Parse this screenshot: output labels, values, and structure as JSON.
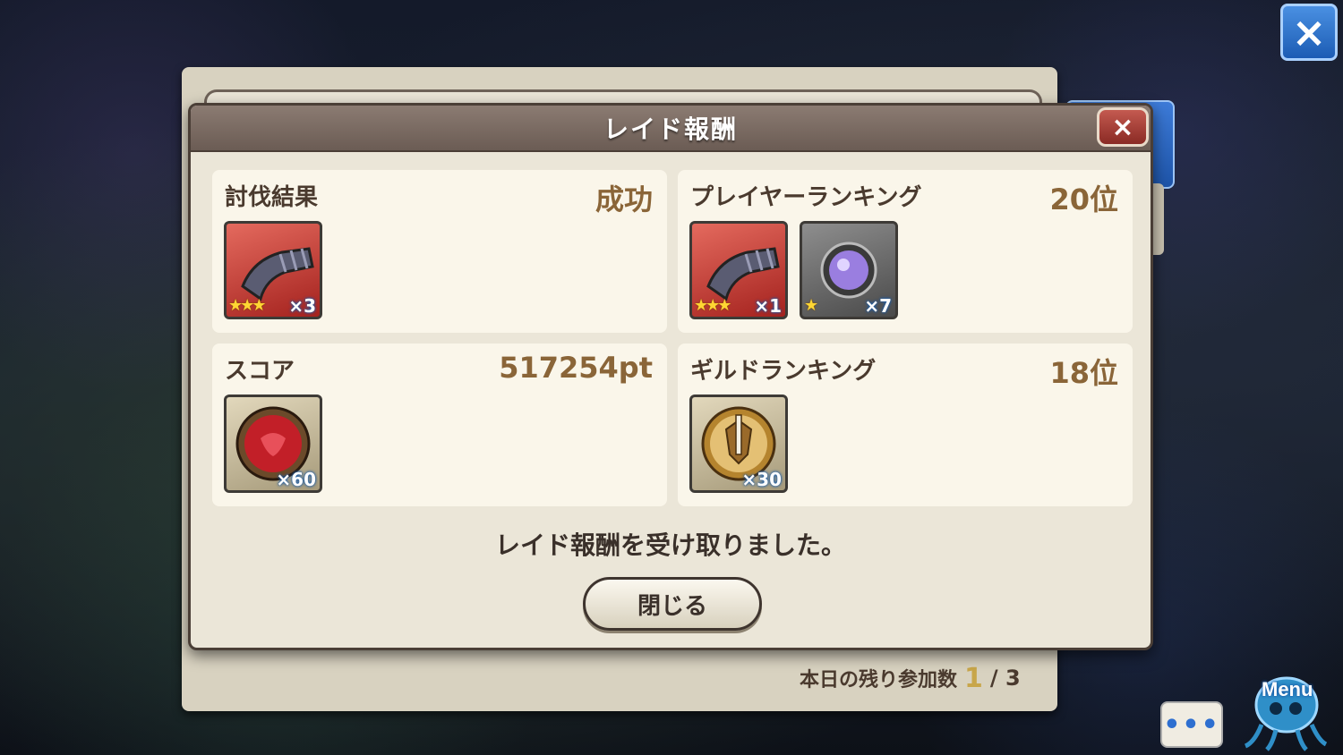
{
  "dialog": {
    "title": "レイド報酬",
    "close_icon": "×",
    "message": "レイド報酬を受け取りました。",
    "close_button_label": "閉じる"
  },
  "cards": {
    "subjugation": {
      "label": "討伐結果",
      "value": "成功",
      "items": [
        {
          "icon": "gauntlet-icon",
          "stars": "★★★",
          "qty": "×3"
        }
      ]
    },
    "player_ranking": {
      "label": "プレイヤーランキング",
      "value": "20位",
      "items": [
        {
          "icon": "gauntlet-icon",
          "stars": "★★★",
          "qty": "×1"
        },
        {
          "icon": "purple-orb-icon",
          "stars": "★",
          "qty": "×7"
        }
      ]
    },
    "score": {
      "label": "スコア",
      "value": "517254pt",
      "items": [
        {
          "icon": "red-gem-medal-icon",
          "qty": "×60"
        }
      ]
    },
    "guild_ranking": {
      "label": "ギルドランキング",
      "value": "18位",
      "items": [
        {
          "icon": "sword-shield-medal-icon",
          "qty": "×30"
        }
      ]
    }
  },
  "footer": {
    "remaining_label": "本日の残り参加数",
    "remaining_count": "1",
    "remaining_total": "/ 3"
  },
  "hud": {
    "top_close_icon": "×",
    "chat_icon": "•••",
    "menu_label": "Menu"
  }
}
